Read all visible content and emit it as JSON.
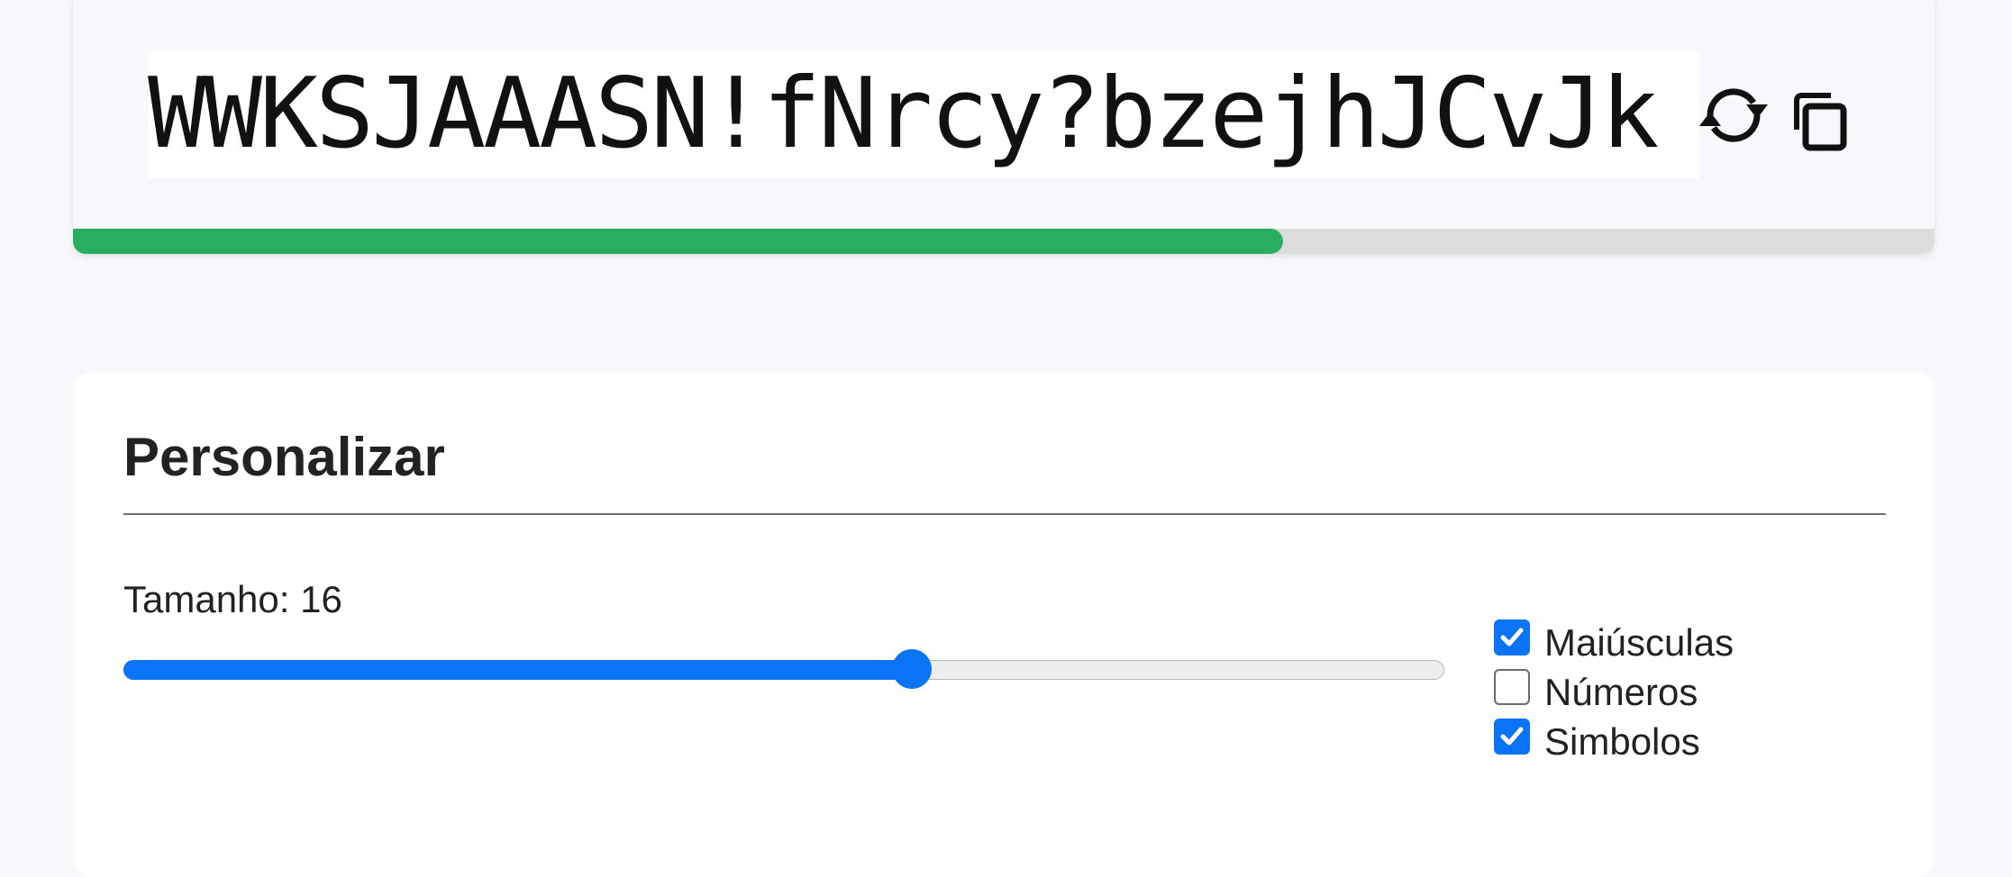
{
  "password": {
    "value": "WWKSJAAASN!fNrcy?bzejhJCvJk",
    "refresh_icon": "refresh-icon",
    "copy_icon": "copy-icon",
    "strength_fraction": 0.65,
    "strength_color": "#27ae60"
  },
  "customize": {
    "title": "Personalizar",
    "length_label": "Tamanho: 16",
    "length_value": 16,
    "slider_fraction": 0.597,
    "accent_color": "#0a73f6",
    "options": [
      {
        "label": "Maiúsculas",
        "checked": true
      },
      {
        "label": "Números",
        "checked": false
      },
      {
        "label": "Simbolos",
        "checked": true
      }
    ]
  }
}
